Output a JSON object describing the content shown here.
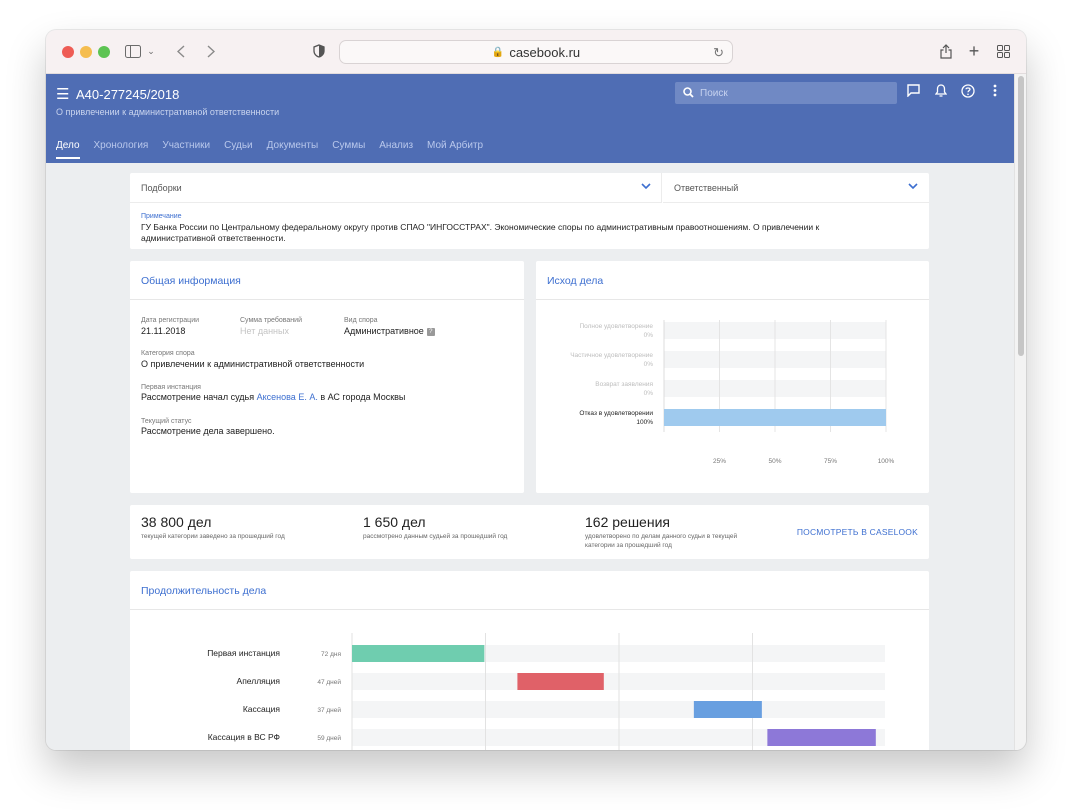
{
  "browser": {
    "url": "casebook.ru"
  },
  "header": {
    "case_number": "А40-277245/2018",
    "case_subtitle": "О привлечении к административной ответственности",
    "search_placeholder": "Поиск",
    "tabs": [
      {
        "label": "Дело",
        "active": true
      },
      {
        "label": "Хронология",
        "active": false
      },
      {
        "label": "Участники",
        "active": false
      },
      {
        "label": "Судьи",
        "active": false
      },
      {
        "label": "Документы",
        "active": false
      },
      {
        "label": "Суммы",
        "active": false
      },
      {
        "label": "Анализ",
        "active": false
      },
      {
        "label": "Мой Арбитр",
        "active": false
      }
    ]
  },
  "filters": {
    "collections_label": "Подборки",
    "responsible_label": "Ответственный",
    "note_label": "Примечание",
    "note_text": "ГУ Банка России по Центральному федеральному округу против СПАО \"ИНГОССТРАХ\". Экономические споры по административным правоотношениям. О привлечении к административной ответственности."
  },
  "general_info": {
    "title": "Общая информация",
    "reg_date_label": "Дата регистрации",
    "reg_date": "21.11.2018",
    "claim_sum_label": "Сумма требований",
    "claim_sum": "Нет данных",
    "dispute_type_label": "Вид спора",
    "dispute_type": "Административное",
    "category_label": "Категория спора",
    "category": "О привлечении к административной ответственности",
    "first_instance_label": "Первая инстанция",
    "first_instance_prefix": "Рассмотрение начал судья",
    "first_instance_judge": "Аксенова Е. А.",
    "first_instance_suffix": "в АС города Москвы",
    "status_label": "Текущий статус",
    "status": "Рассмотрение дела завершено."
  },
  "outcome": {
    "title": "Исход дела"
  },
  "stats": {
    "cases_total": "38 800 дел",
    "cases_total_caption": "текущей категории заведено за прошедший год",
    "cases_judge": "1 650 дел",
    "cases_judge_caption": "рассмотрено данным судьей за прошедший год",
    "decisions": "162 решения",
    "decisions_caption_1": "удовлетворено по делам данного судьи в текущей",
    "decisions_caption_2": "категории за прошедший год",
    "caselook_link": "ПОСМОТРЕТЬ В CASELOOK"
  },
  "duration": {
    "title": "Продолжительность дела"
  },
  "colors": {
    "header_bg": "#4f6db4",
    "accent": "#3d6fd0",
    "outcome_bar": "#9fcaee"
  },
  "icons": [
    "hamburger-menu-icon",
    "search-icon",
    "chat-icon",
    "bell-icon",
    "help-icon",
    "more-vertical-icon",
    "chevron-down-icon",
    "lock-icon",
    "reload-icon",
    "sidebar-icon",
    "back-icon",
    "forward-icon",
    "shield-icon",
    "share-icon",
    "plus-icon",
    "tabs-grid-icon"
  ],
  "chart_data": [
    {
      "type": "bar",
      "orientation": "horizontal",
      "title": "Исход дела",
      "categories": [
        "Полное удовлетворение",
        "Частичное удовлетворение",
        "Возврат заявления",
        "Отказ в удовлетворении"
      ],
      "values": [
        0,
        0,
        0,
        100
      ],
      "value_labels": [
        "0%",
        "0%",
        "0%",
        "100%"
      ],
      "x_ticks": [
        "25%",
        "50%",
        "75%",
        "100%"
      ],
      "xlim": [
        0,
        100
      ],
      "grid": true
    },
    {
      "type": "bar",
      "orientation": "horizontal-gantt",
      "title": "Продолжительность дела",
      "series": [
        {
          "name": "Первая инстанция",
          "days_label": "72 дня",
          "start": 0,
          "end": 72,
          "color": "#6fcdaf"
        },
        {
          "name": "Апелляция",
          "days_label": "47 дней",
          "start": 90,
          "end": 137,
          "color": "#e06168"
        },
        {
          "name": "Кассация",
          "days_label": "37 дней",
          "start": 186,
          "end": 223,
          "color": "#689fe0"
        },
        {
          "name": "Кассация в ВС РФ",
          "days_label": "59 дней",
          "start": 226,
          "end": 285,
          "color": "#8d78d8"
        }
      ],
      "grid": true
    }
  ]
}
